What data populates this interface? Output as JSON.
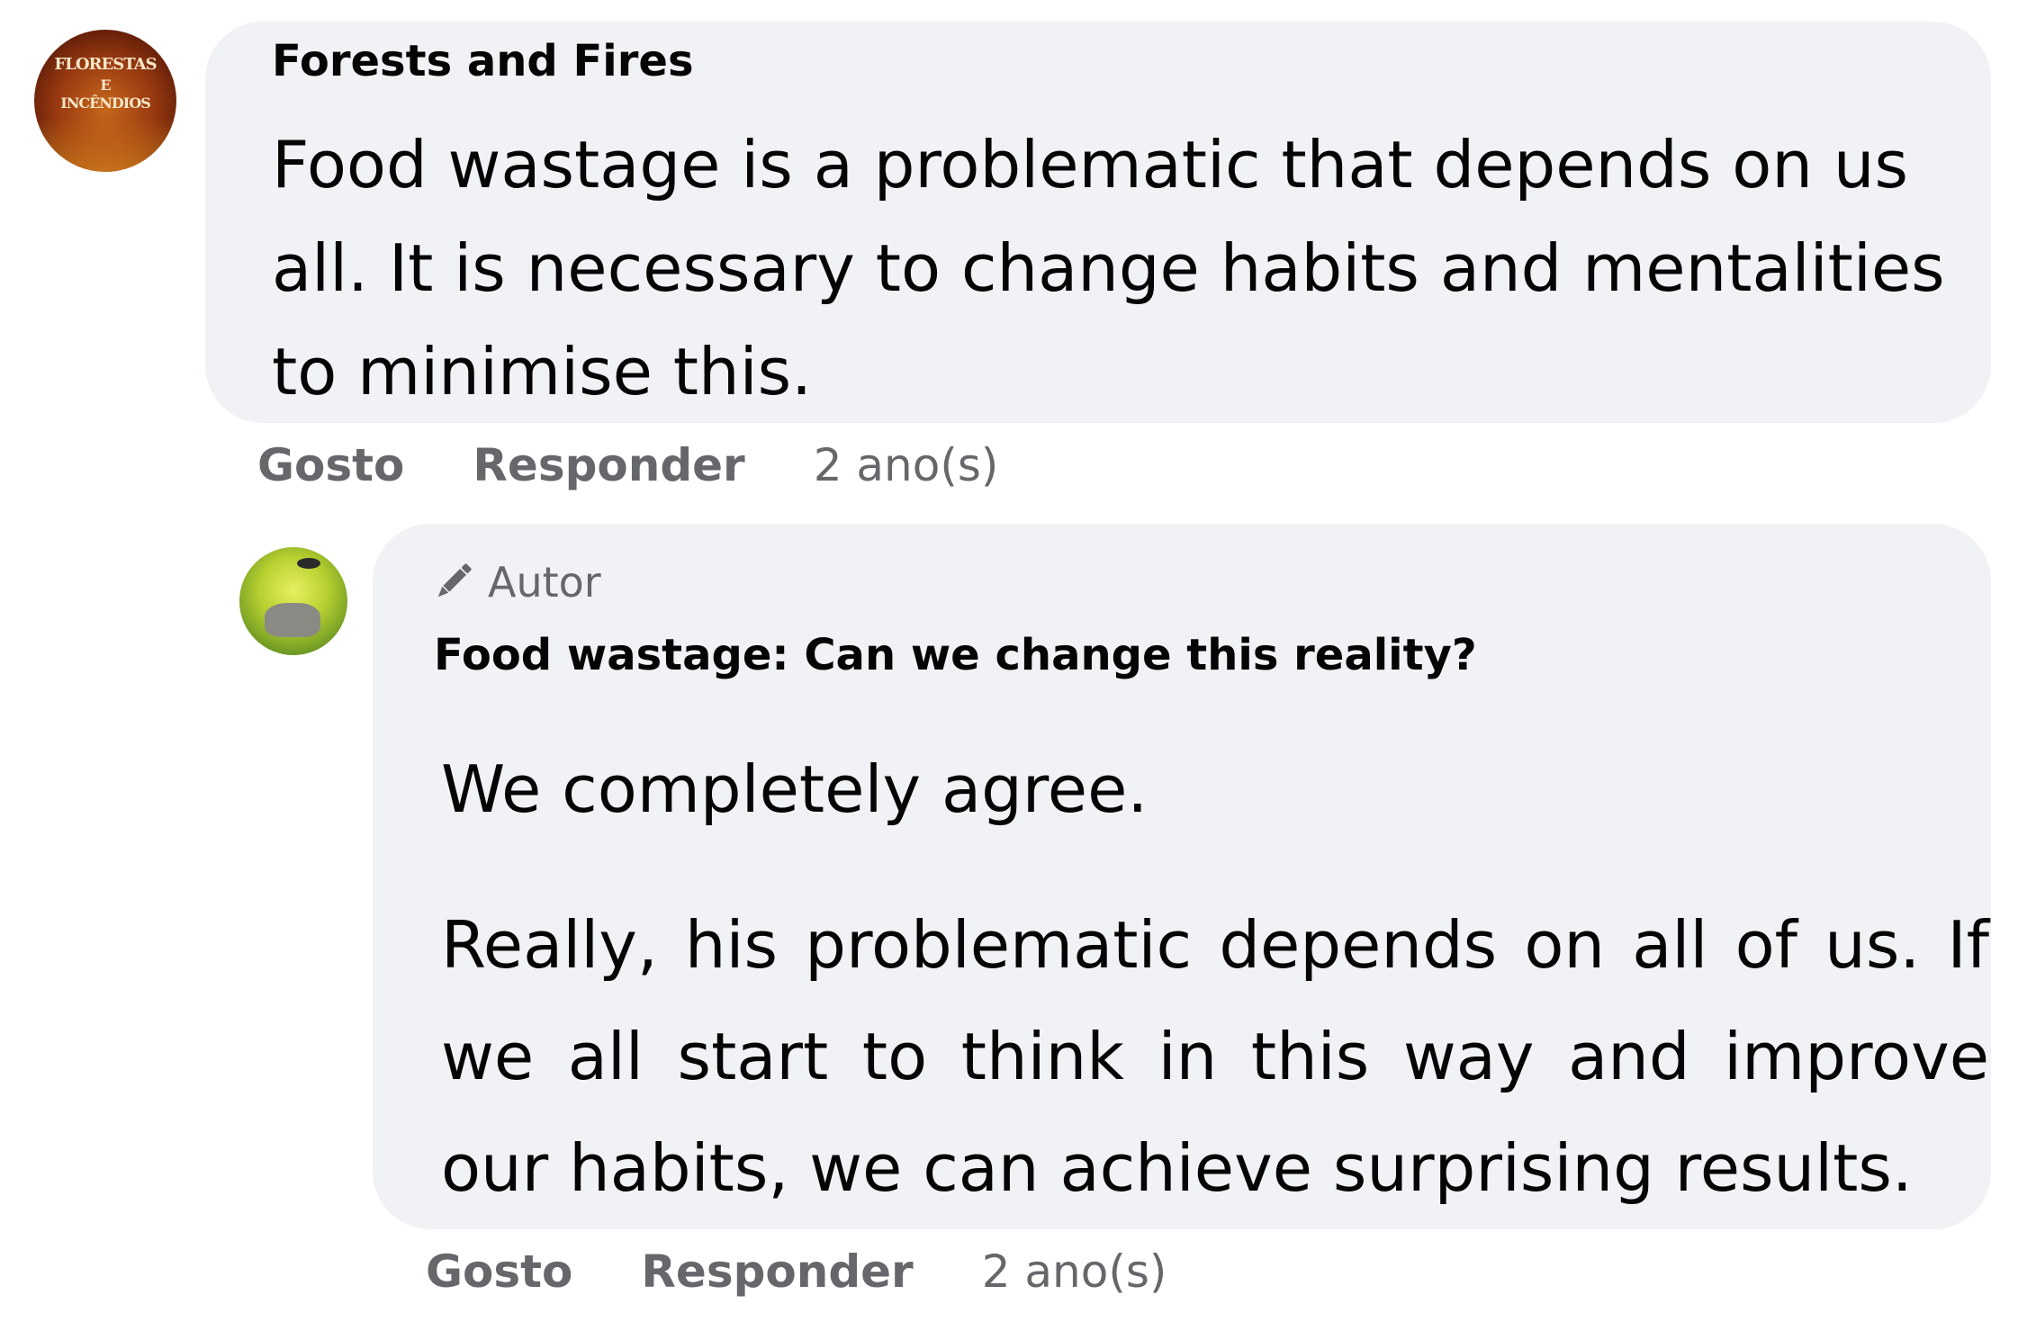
{
  "comment1": {
    "avatar_text": [
      "FLORESTAS",
      "E",
      "INCÊNDIOS"
    ],
    "author": "Forests and Fires",
    "text": "Food wastage is a problematic that depends on us all. It is necessary to change habits and mentalities to minimise this.",
    "actions": {
      "like": "Gosto",
      "reply": "Responder",
      "time": "2 ano(s)"
    }
  },
  "comment2": {
    "badge": {
      "icon": "pencil-icon",
      "label": "Autor"
    },
    "author": "Food wastage: Can we change this reality?",
    "paragraphs": [
      "We completely agree.",
      "Really, his problematic depends on all of us. If we all start to think in this way and improve our habits, we can achieve surprising results."
    ],
    "actions": {
      "like": "Gosto",
      "reply": "Responder",
      "time": "2 ano(s)"
    }
  },
  "colors": {
    "bubble_bg": "#f0f2f5",
    "text": "#050505",
    "secondary_text": "#65676b"
  }
}
